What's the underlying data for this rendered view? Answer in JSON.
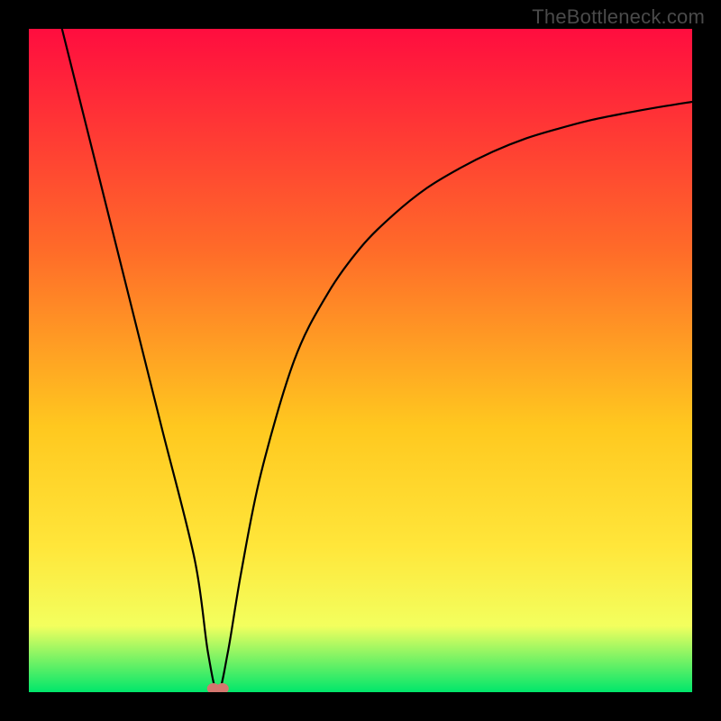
{
  "watermark": "TheBottleneck.com",
  "colors": {
    "background": "#000000",
    "gradient_top": "#ff0d3f",
    "gradient_mid1": "#ff6a29",
    "gradient_mid2": "#ffc81f",
    "gradient_mid3": "#ffe63a",
    "gradient_mid4": "#f3ff5e",
    "gradient_bottom": "#00e66b",
    "curve": "#000000",
    "marker": "#d4776f"
  },
  "chart_data": {
    "type": "line",
    "title": "",
    "xlabel": "",
    "ylabel": "",
    "x_range": [
      0,
      100
    ],
    "y_range": [
      0,
      100
    ],
    "series": [
      {
        "name": "bottleneck-curve",
        "x": [
          5,
          10,
          15,
          20,
          25,
          27,
          28.5,
          30,
          32,
          35,
          40,
          45,
          50,
          55,
          60,
          65,
          70,
          75,
          80,
          85,
          90,
          95,
          100
        ],
        "y": [
          100,
          80,
          60,
          40,
          20,
          6,
          0,
          6,
          18,
          33,
          50,
          60,
          67,
          72,
          76,
          79,
          81.5,
          83.5,
          85,
          86.3,
          87.3,
          88.2,
          89
        ]
      }
    ],
    "markers": [
      {
        "name": "optimal-point",
        "x": 28.5,
        "y": 0
      }
    ],
    "annotations": []
  }
}
